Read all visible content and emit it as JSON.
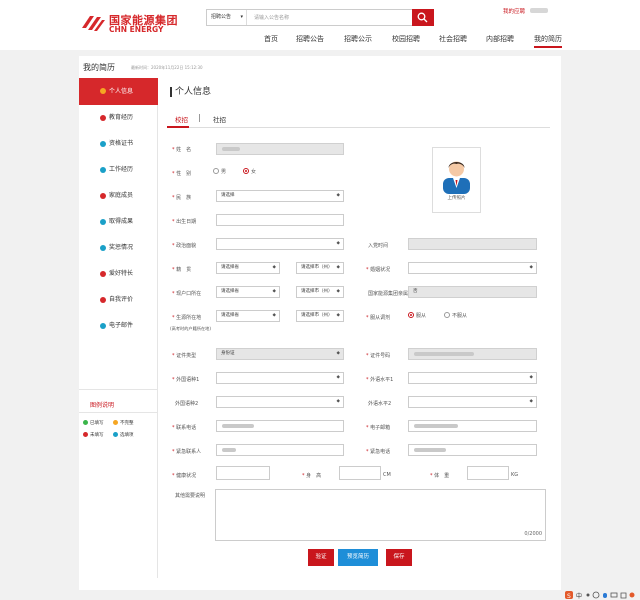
{
  "header": {
    "logo_cn": "国家能源集团",
    "logo_en": "CHN ENERGY",
    "search_category": "招聘公告",
    "search_placeholder": "请输入公告名称",
    "user_link": "我的应聘",
    "nav": [
      "首页",
      "招聘公告",
      "招聘公示",
      "校园招聘",
      "社会招聘",
      "内部招聘",
      "我的简历"
    ],
    "active_nav": "我的简历"
  },
  "page": {
    "title": "我的简历",
    "updated": "最新时间：2020年11月22日 15:12:30",
    "section_title": "个人信息",
    "tabs": [
      "校招",
      "社招"
    ],
    "active_tab": "校招"
  },
  "sidebar": {
    "items": [
      {
        "label": "个人信息",
        "status": "current"
      },
      {
        "label": "教育经历",
        "status": "unfilled"
      },
      {
        "label": "资格证书",
        "status": "optional"
      },
      {
        "label": "工作经历",
        "status": "optional"
      },
      {
        "label": "家庭成员",
        "status": "unfilled"
      },
      {
        "label": "取得成果",
        "status": "optional"
      },
      {
        "label": "奖惩情况",
        "status": "optional"
      },
      {
        "label": "爱好特长",
        "status": "unfilled"
      },
      {
        "label": "自我评价",
        "status": "unfilled"
      },
      {
        "label": "电子邮件",
        "status": "optional"
      }
    ],
    "legend_title": "图例说明",
    "legend": [
      "已填写",
      "不完整",
      "未填写",
      "选填项"
    ],
    "status_colors": {
      "filled": "#3ab54a",
      "incomplete": "#f5a623",
      "unfilled": "#d6282b",
      "optional": "#1aa0c8"
    }
  },
  "form": {
    "name_label": "姓　名",
    "gender_label": "性　别",
    "gender_options": [
      "男",
      "女"
    ],
    "gender_selected": "女",
    "ethnicity_label": "民　族",
    "select_placeholder": "请选择",
    "birth_label": "出生日期",
    "political_label": "政治面貌",
    "party_time_label": "入党时间",
    "origin_label": "籍　贯",
    "province_placeholder": "请选择省",
    "city_placeholder": "请选择市（州）",
    "marital_label": "婚姻状况",
    "hukou_label": "现户口所在",
    "relative_label": "国家能源集团亲属",
    "relative_value": "否",
    "birthplace_label": "生源所在地",
    "birthplace_note": "(高考时的户籍所在地)",
    "adjust_label": "服从调剂",
    "adjust_options": [
      "服从",
      "不服从"
    ],
    "adjust_selected": "服从",
    "id_type_label": "证件类型",
    "id_type_value": "身份证",
    "id_number_label": "证件号码",
    "lang1_label": "外国语种1",
    "lang1_level_label": "外语水平1",
    "lang2_label": "外国语种2",
    "lang2_level_label": "外语水平2",
    "phone_label": "联系电话",
    "email_label": "电子邮箱",
    "emergency_contact_label": "紧急联系人",
    "emergency_phone_label": "紧急电话",
    "health_label": "健康状况",
    "height_label": "身　高",
    "height_unit": "CM",
    "weight_label": "体　重",
    "weight_unit": "KG",
    "notes_label": "其他需要说明",
    "notes_counter": "0/2000",
    "photo_label": "上传照片"
  },
  "actions": {
    "verify": "验证",
    "preview": "预览简历",
    "save": "保存"
  },
  "colors": {
    "brand_red": "#c9161d",
    "preview_blue": "#1e8ed8"
  }
}
